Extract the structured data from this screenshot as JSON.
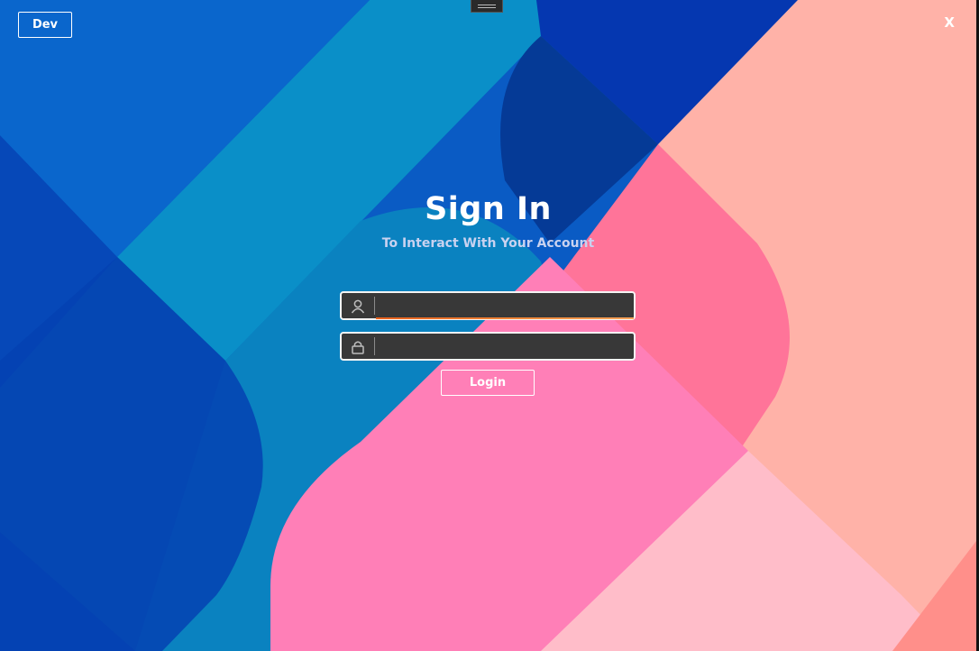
{
  "window": {
    "dev_label": "Dev",
    "close_label": "X"
  },
  "signin": {
    "title": "Sign In",
    "subtitle": "To Interact With Your Account",
    "username": {
      "value": "",
      "icon": "user-icon"
    },
    "password": {
      "value": "",
      "icon": "lock-icon"
    },
    "login_label": "Login"
  },
  "colors": {
    "accent_underline": "#e8611e",
    "field_bg": "#383838",
    "blue": "#0a4fa8",
    "pink": "#ff7fb7",
    "salmon": "#ffb4a9"
  }
}
